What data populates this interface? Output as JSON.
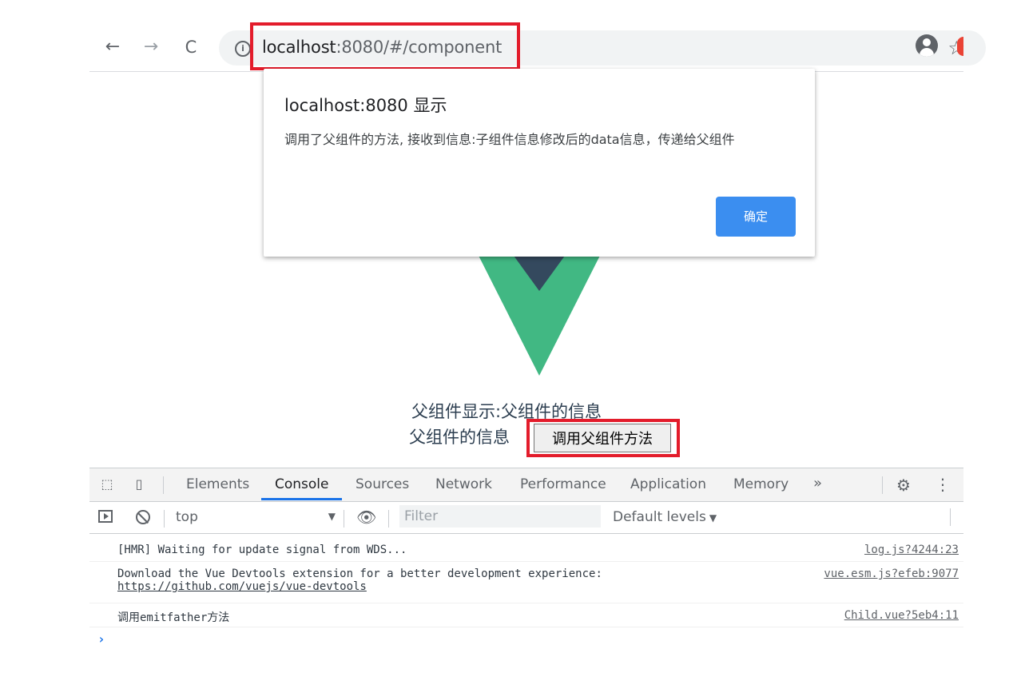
{
  "browser": {
    "back_icon": "←",
    "forward_icon": "→",
    "reload_icon": "C",
    "info_icon": "i",
    "url_host": "localhost",
    "url_rest": ":8080/#/component",
    "bookmark_icon": "☆"
  },
  "alert": {
    "title": "localhost:8080 显示",
    "message": "调用了父组件的方法, 接收到信息:子组件信息修改后的data信息，传递给父组件",
    "ok_label": "确定"
  },
  "page": {
    "line1": "父组件显示:父组件的信息",
    "line2": "父组件的信息",
    "button_label": "调用父组件方法"
  },
  "devtools": {
    "tabs": [
      "Elements",
      "Console",
      "Sources",
      "Network",
      "Performance",
      "Application",
      "Memory"
    ],
    "active_tab": "Console",
    "more_icon": "»",
    "settings_icon": "⚙",
    "menu_icon": "⋮",
    "context": "top",
    "filter_placeholder": "Filter",
    "levels": "Default levels",
    "console": [
      {
        "text": "[HMR] Waiting for update signal from WDS...",
        "link": "",
        "source": "log.js?4244:23"
      },
      {
        "text": "Download the Vue Devtools extension for a better development experience:",
        "link": "https://github.com/vuejs/vue-devtools",
        "source": "vue.esm.js?efeb:9077"
      },
      {
        "text": "调用emitfather方法",
        "link": "",
        "source": "Child.vue?5eb4:11"
      }
    ],
    "prompt": "›"
  },
  "colors": {
    "highlight": "#e31c2b",
    "vue_green": "#41b883",
    "vue_dark": "#34495e",
    "alert_button": "#3b8ef0",
    "tab_active": "#1a73e8"
  }
}
